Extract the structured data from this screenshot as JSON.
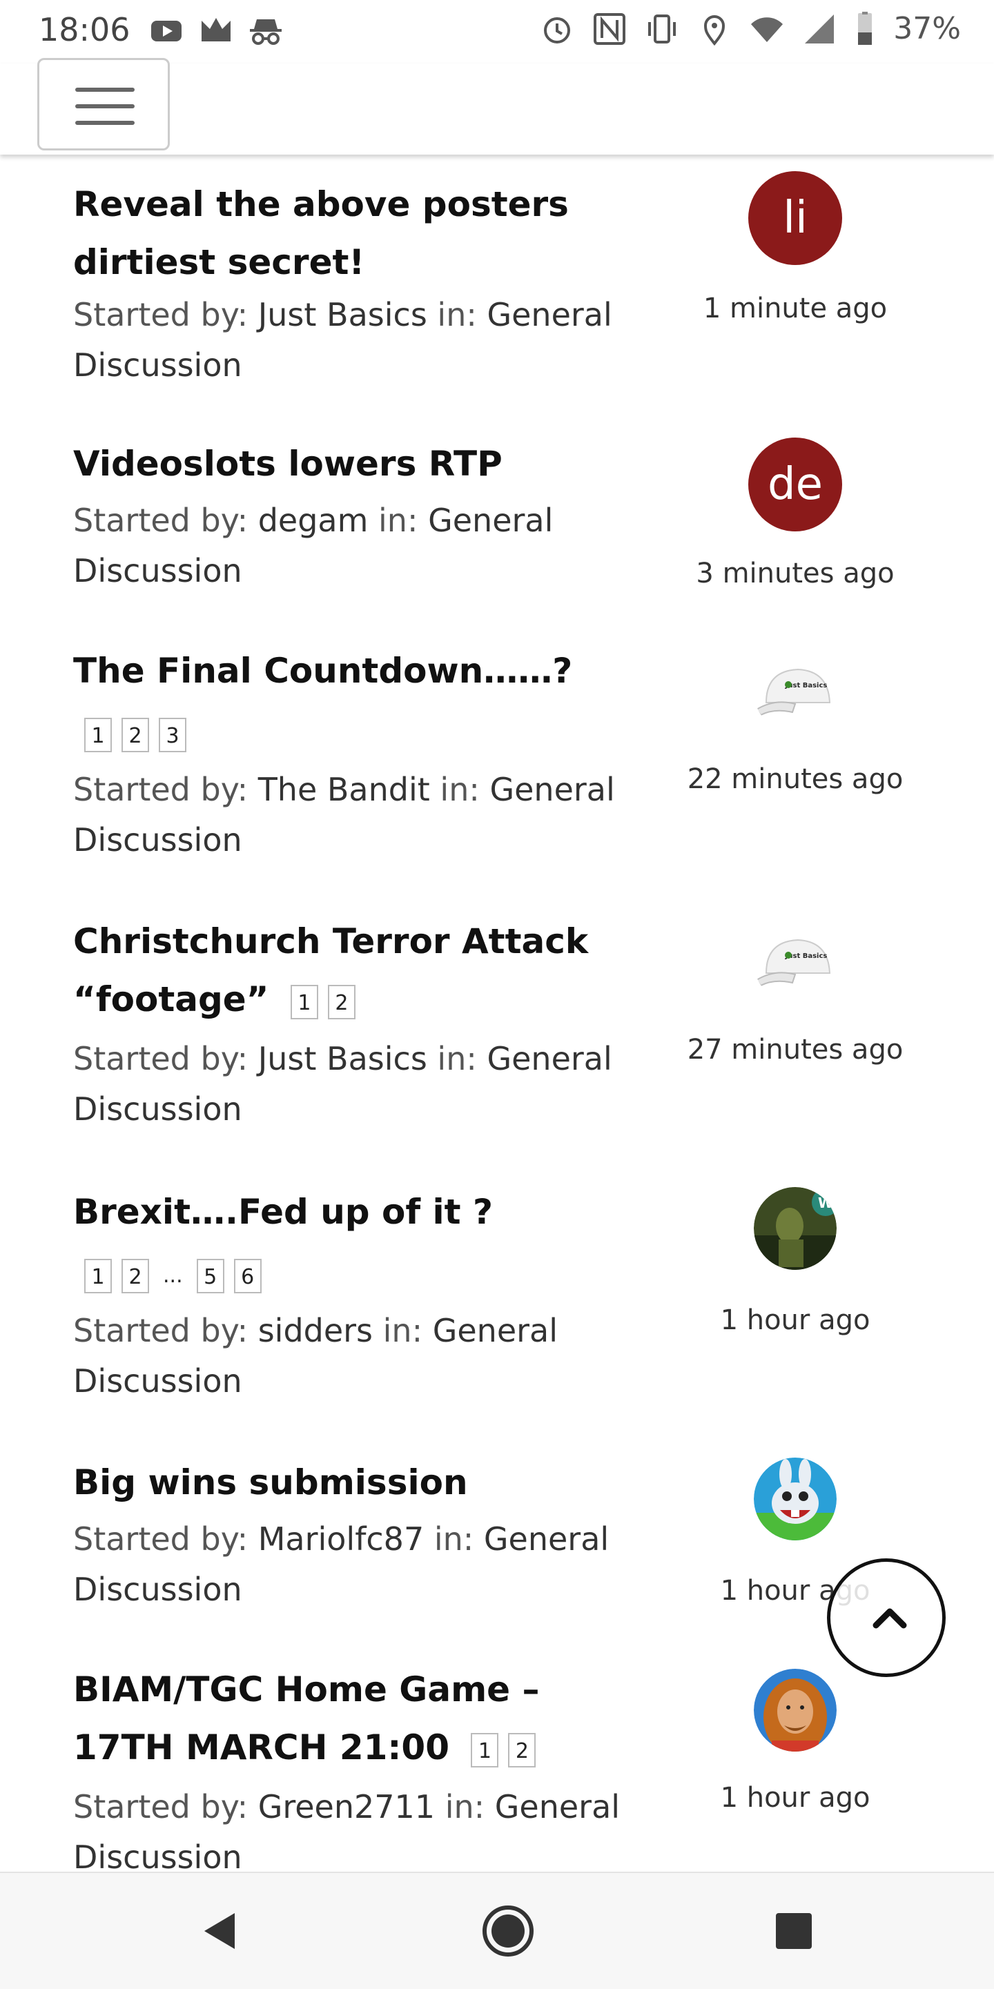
{
  "status_bar": {
    "time": "18:06",
    "battery": "37%",
    "left_icons": [
      "youtube-icon",
      "crown-icon",
      "incognito-icon"
    ],
    "right_icons": [
      "alarm-icon",
      "nfc-icon",
      "vibrate-icon",
      "location-icon",
      "wifi-icon",
      "signal-icon",
      "battery-icon"
    ]
  },
  "header": {
    "menu_icon": "hamburger-icon"
  },
  "topics": [
    {
      "title_lines": [
        "Reveal the above posters",
        "dirtiest secret!"
      ],
      "pages": [],
      "started_by_label": "Started by:",
      "author": "Just Basics",
      "in_label": "in:",
      "board_line1": "General",
      "board_line2": "Discussion",
      "avatar_text": "li",
      "time": "1 minute ago"
    },
    {
      "title_lines": [
        "Videoslots lowers RTP"
      ],
      "pages": [],
      "started_by_label": "Started by:",
      "author": "degam",
      "in_label": "in:",
      "board_line1": "General",
      "board_line2": "Discussion",
      "avatar_text": "de",
      "time": "3 minutes ago"
    },
    {
      "title_lines": [
        "The Final Countdown……?"
      ],
      "pages": [
        "1",
        "2",
        "3"
      ],
      "started_by_label": "Started by:",
      "author": "The Bandit",
      "in_label": "in:",
      "board_line1": "General",
      "board_line2": "Discussion",
      "avatar_image": "cap-avatar",
      "avatar_caption": "Just Basics",
      "time": "22 minutes ago"
    },
    {
      "title_lines": [
        "Christchurch Terror Attack",
        "“footage”"
      ],
      "pages": [
        "1",
        "2"
      ],
      "started_by_label": "Started by:",
      "author": "Just Basics",
      "in_label": "in:",
      "board_line1": "General",
      "board_line2": "Discussion",
      "avatar_image": "cap-avatar",
      "avatar_caption": "Just Basics",
      "time": "27 minutes ago"
    },
    {
      "title_lines": [
        "Brexit….Fed up of it ?"
      ],
      "pages": [
        "1",
        "2",
        "...",
        "5",
        "6"
      ],
      "started_by_label": "Started by:",
      "author": "sidders",
      "in_label": "in:",
      "board_line1": "General",
      "board_line2": "Discussion",
      "avatar_image": "warrior-avatar",
      "time": "1 hour ago"
    },
    {
      "title_lines": [
        "Big wins submission"
      ],
      "pages": [],
      "started_by_label": "Started by:",
      "author": "Mariolfc87",
      "in_label": "in:",
      "board_line1": "General",
      "board_line2": "Discussion",
      "avatar_image": "rabbit-avatar",
      "time": "1 hour ago"
    },
    {
      "title_lines": [
        "BIAM/TGC Home Game –",
        "17TH MARCH 21:00"
      ],
      "pages": [
        "1",
        "2"
      ],
      "started_by_label": "Started by:",
      "author": "Green2711",
      "in_label": "in:",
      "board_line1": "General",
      "board_line2": "Discussion",
      "avatar_image": "portrait-avatar",
      "time": "1 hour ago"
    }
  ],
  "back_to_top_icon": "chevron-up-icon",
  "nav_bar": {
    "icons": [
      "back-icon",
      "home-icon",
      "recents-icon"
    ]
  }
}
